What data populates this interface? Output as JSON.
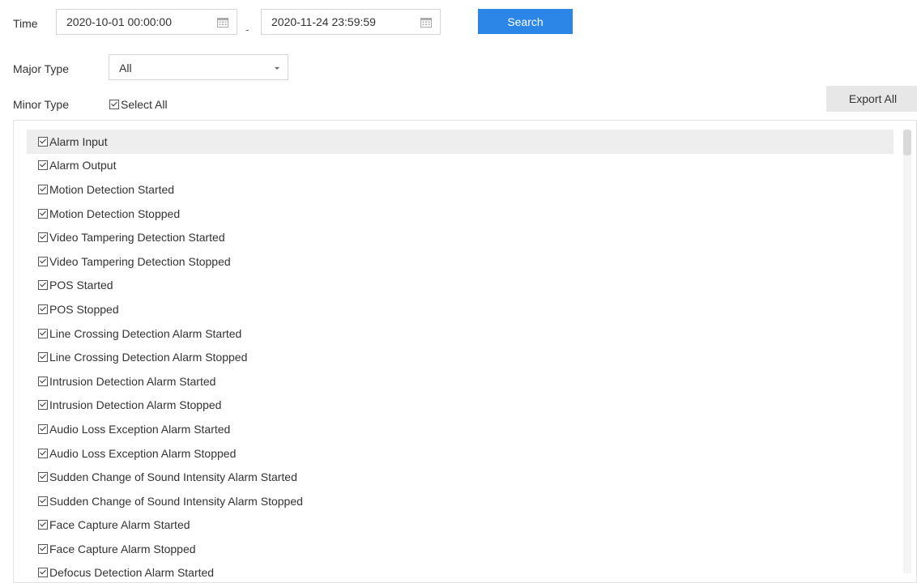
{
  "filters": {
    "time_label": "Time",
    "start_time": "2020-10-01 00:00:00",
    "range_separator": "-",
    "end_time": "2020-11-24 23:59:59",
    "search_label": "Search",
    "major_type_label": "Major Type",
    "major_type_value": "All",
    "minor_type_label": "Minor Type",
    "select_all_label": "Select All",
    "select_all_checked": true,
    "export_all_label": "Export All"
  },
  "minor_types": [
    {
      "label": "Alarm Input",
      "checked": true
    },
    {
      "label": "Alarm Output",
      "checked": true
    },
    {
      "label": "Motion Detection Started",
      "checked": true
    },
    {
      "label": "Motion Detection Stopped",
      "checked": true
    },
    {
      "label": "Video Tampering Detection Started",
      "checked": true
    },
    {
      "label": "Video Tampering Detection Stopped",
      "checked": true
    },
    {
      "label": "POS Started",
      "checked": true
    },
    {
      "label": "POS Stopped",
      "checked": true
    },
    {
      "label": "Line Crossing Detection Alarm Started",
      "checked": true
    },
    {
      "label": "Line Crossing Detection Alarm Stopped",
      "checked": true
    },
    {
      "label": "Intrusion Detection Alarm Started",
      "checked": true
    },
    {
      "label": "Intrusion Detection Alarm Stopped",
      "checked": true
    },
    {
      "label": "Audio Loss Exception Alarm Started",
      "checked": true
    },
    {
      "label": "Audio Loss Exception Alarm Stopped",
      "checked": true
    },
    {
      "label": "Sudden Change of Sound Intensity Alarm Started",
      "checked": true
    },
    {
      "label": "Sudden Change of Sound Intensity Alarm Stopped",
      "checked": true
    },
    {
      "label": "Face Capture Alarm Started",
      "checked": true
    },
    {
      "label": "Face Capture Alarm Stopped",
      "checked": true
    },
    {
      "label": "Defocus Detection Alarm Started",
      "checked": true
    }
  ],
  "colors": {
    "accent": "#2b86e8",
    "highlight_row": "#eeeeee"
  }
}
